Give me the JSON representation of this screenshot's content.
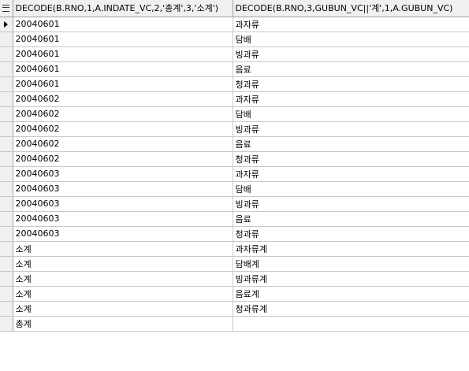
{
  "grid": {
    "columns": [
      "DECODE(B.RNO,1,A.INDATE_VC,2,'총계',3,'소계')",
      "DECODE(B.RNO,3,GUBUN_VC||'계',1,A.GUBUN_VC)"
    ],
    "rows": [
      [
        "20040601",
        "과자류"
      ],
      [
        "20040601",
        "담배"
      ],
      [
        "20040601",
        "빙과류"
      ],
      [
        "20040601",
        "음료"
      ],
      [
        "20040601",
        "청과류"
      ],
      [
        "20040602",
        "과자류"
      ],
      [
        "20040602",
        "담배"
      ],
      [
        "20040602",
        "빙과류"
      ],
      [
        "20040602",
        "음료"
      ],
      [
        "20040602",
        "청과류"
      ],
      [
        "20040603",
        "과자류"
      ],
      [
        "20040603",
        "담배"
      ],
      [
        "20040603",
        "빙과류"
      ],
      [
        "20040603",
        "음료"
      ],
      [
        "20040603",
        "청과류"
      ],
      [
        "소계",
        "과자류계"
      ],
      [
        "소계",
        "담배계"
      ],
      [
        "소계",
        "빙과류계"
      ],
      [
        "소계",
        "음료계"
      ],
      [
        "소계",
        "청과류계"
      ],
      [
        "총계",
        ""
      ]
    ],
    "current_row": 0
  }
}
